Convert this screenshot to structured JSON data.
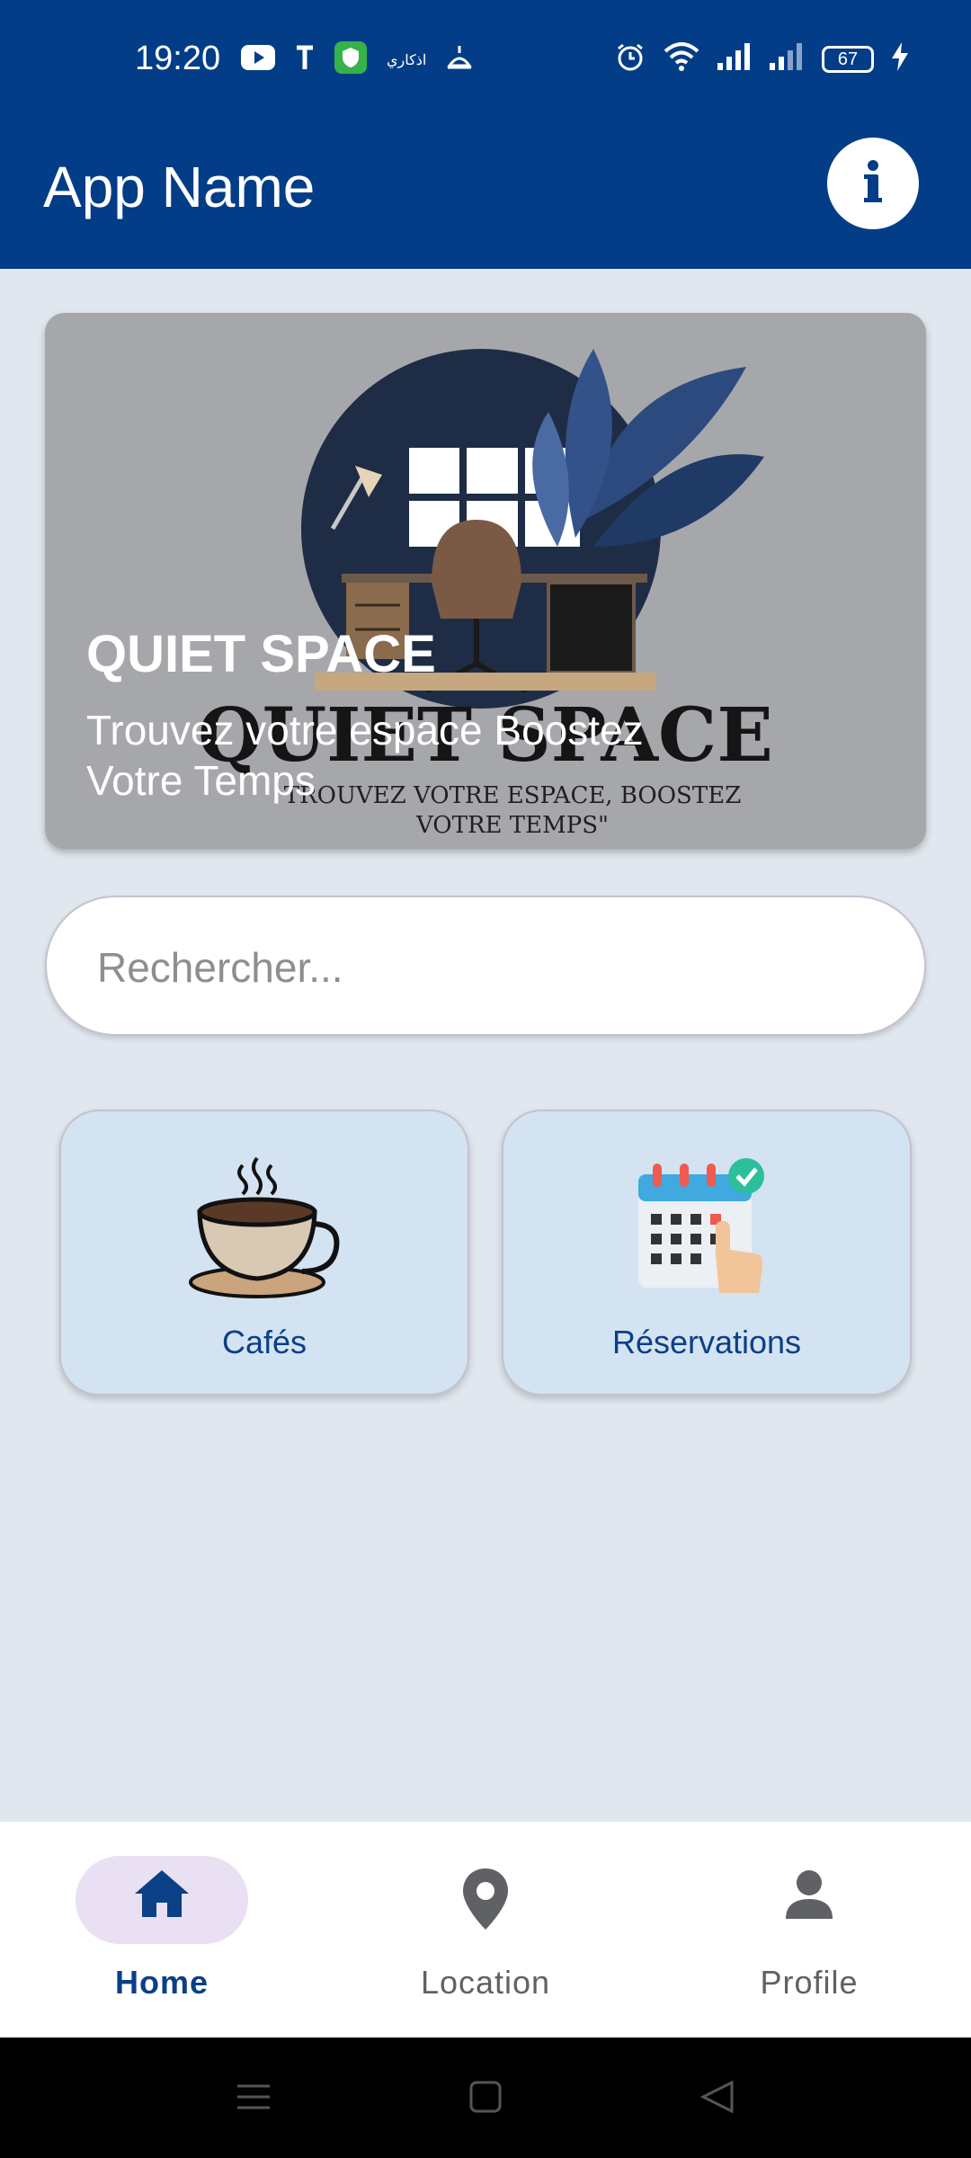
{
  "status_bar": {
    "time": "19:20",
    "small_app_text": "اذكاري",
    "battery": "67",
    "icons": [
      "youtube-icon",
      "t-icon",
      "shield-icon",
      "adhkar-icon",
      "mosque-icon",
      "alarm-icon",
      "wifi-icon",
      "signal-icon",
      "signal-icon-2",
      "battery-icon",
      "charging-icon"
    ]
  },
  "app_bar": {
    "title": "App Name",
    "info_icon": "info-icon"
  },
  "banner": {
    "title": "QUIET SPACE",
    "subtitle": "Trouvez votre espace Boostez Votre Temps",
    "logo_text": "QUIET SPACE",
    "logo_tagline_line1": "TROUVEZ VOTRE ESPACE, BOOSTEZ",
    "logo_tagline_line2": "VOTRE TEMPS\""
  },
  "search": {
    "placeholder": "Rechercher...",
    "value": ""
  },
  "categories": [
    {
      "label": "Cafés",
      "icon": "coffee-cup-icon"
    },
    {
      "label": "Réservations",
      "icon": "calendar-reservation-icon"
    }
  ],
  "bottom_nav": {
    "items": [
      {
        "label": "Home",
        "icon": "home-icon",
        "active": true
      },
      {
        "label": "Location",
        "icon": "location-pin-icon",
        "active": false
      },
      {
        "label": "Profile",
        "icon": "person-icon",
        "active": false
      }
    ]
  },
  "colors": {
    "primary": "#033d87",
    "background": "#e0e7ef",
    "card": "#d4e3f2",
    "nav_active_pill": "#e9e0f3"
  }
}
